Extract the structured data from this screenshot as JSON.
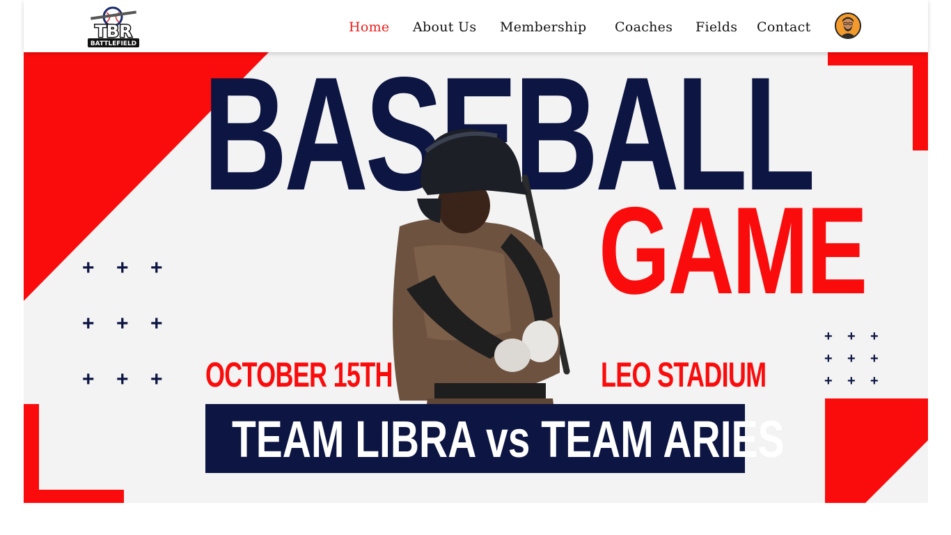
{
  "header": {
    "logo": {
      "top_text": "TBR",
      "bottom_text": "BATTLEFIELD"
    },
    "nav": [
      {
        "label": "Home",
        "active": true
      },
      {
        "label": "About Us",
        "active": false
      },
      {
        "label": "Membership",
        "active": false
      },
      {
        "label": "Coaches",
        "active": false
      },
      {
        "label": "Fields",
        "active": false
      },
      {
        "label": "Contact",
        "active": false
      }
    ],
    "avatar": "user-avatar"
  },
  "hero": {
    "title": "BASEBALL",
    "subtitle": "GAME",
    "date": "OCTOBER 15TH",
    "venue": "LEO STADIUM",
    "matchup": "TEAM LIBRA vs TEAM ARIES",
    "decor_symbol": "+"
  },
  "colors": {
    "navy": "#0d1542",
    "red": "#fb0c0c",
    "nav_active": "#e81d1d",
    "hero_bg": "#f3f3f3"
  }
}
